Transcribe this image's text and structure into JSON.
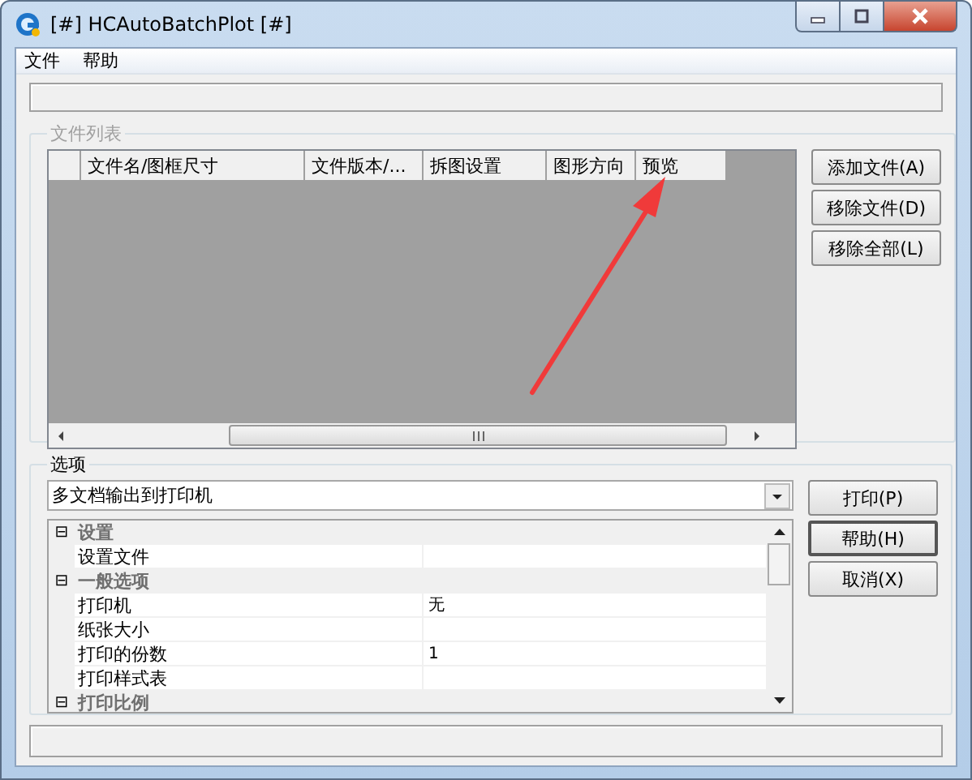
{
  "window": {
    "title": "[#] HCAutoBatchPlot [#]"
  },
  "menu": [
    {
      "label": "文件"
    },
    {
      "label": "帮助"
    }
  ],
  "file_list": {
    "title": "文件列表",
    "columns": [
      "文件名/图框尺寸",
      "文件版本/...",
      "拆图设置",
      "图形方向",
      "预览"
    ],
    "buttons": [
      "添加文件(A)",
      "移除文件(D)",
      "移除全部(L)"
    ]
  },
  "options": {
    "title": "选项",
    "dropdown": {
      "value": "多文档输出到打印机"
    },
    "properties": [
      {
        "kind": "category",
        "toggle": "⊟",
        "name": "设置"
      },
      {
        "kind": "property",
        "name": "设置文件"
      },
      {
        "kind": "category",
        "toggle": "⊟",
        "name": "一般选项"
      },
      {
        "kind": "property",
        "name": "打印机",
        "value": "无"
      },
      {
        "kind": "property",
        "name": "纸张大小"
      },
      {
        "kind": "property",
        "name": "打印的份数",
        "value": "1"
      },
      {
        "kind": "property",
        "name": "打印样式表"
      },
      {
        "kind": "category",
        "toggle": "⊟",
        "name": "打印比例"
      }
    ],
    "buttons": [
      {
        "label": "打印(P)",
        "default": false
      },
      {
        "label": "帮助(H)",
        "default": true
      },
      {
        "label": "取消(X)",
        "default": false
      }
    ]
  }
}
